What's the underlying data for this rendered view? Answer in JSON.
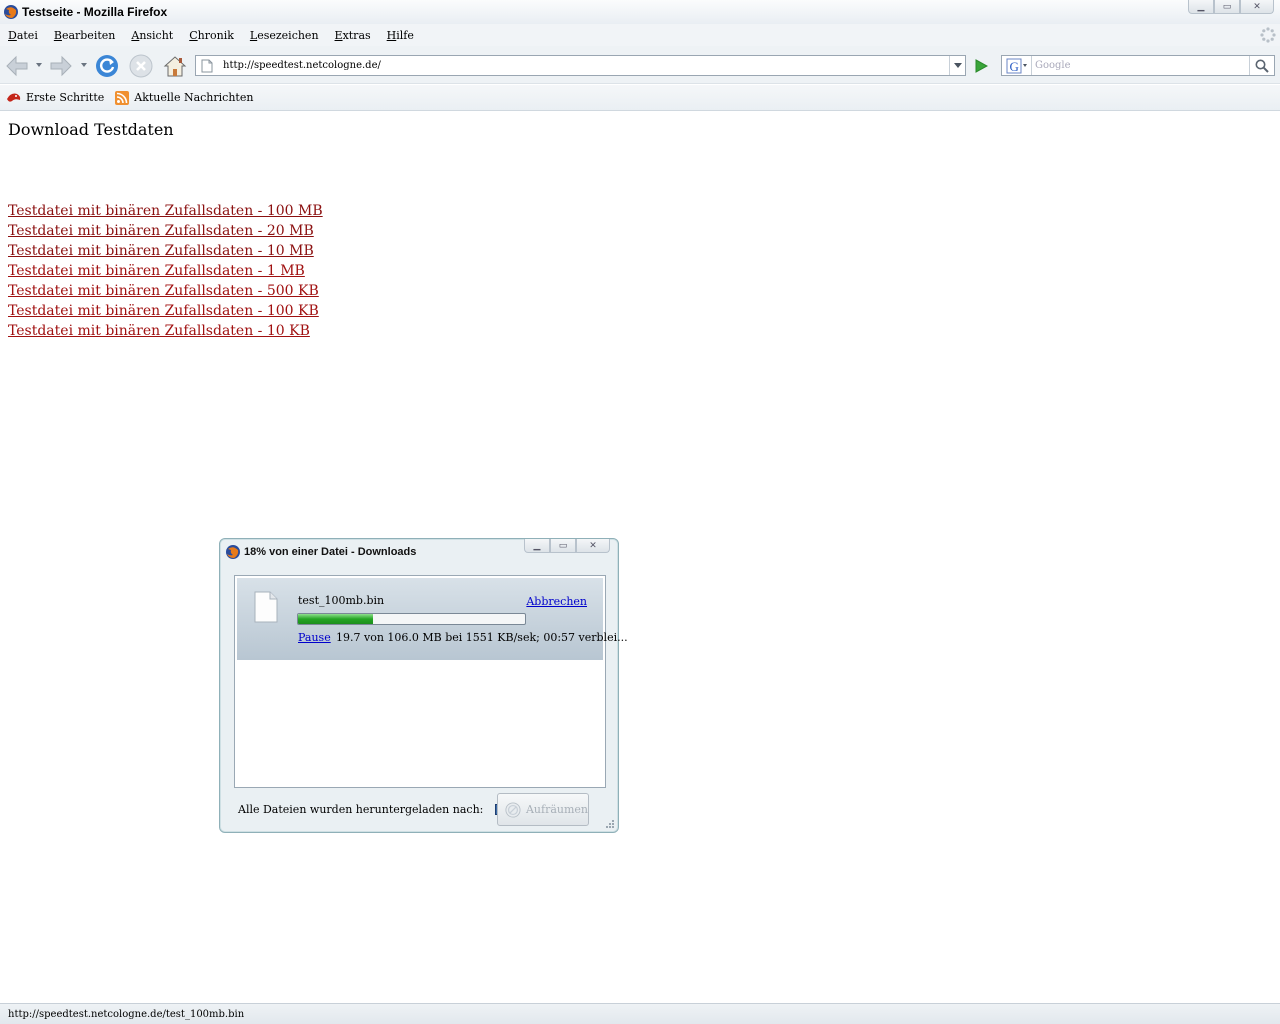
{
  "window": {
    "title": "Testseite - Mozilla Firefox",
    "controls": {
      "minimize": "▭",
      "maximize": "▭",
      "close": "✕"
    }
  },
  "menu": [
    {
      "label": "Datei",
      "accel": "D",
      "rest": "atei"
    },
    {
      "label": "Bearbeiten",
      "accel": "B",
      "rest": "earbeiten"
    },
    {
      "label": "Ansicht",
      "accel": "A",
      "rest": "nsicht"
    },
    {
      "label": "Chronik",
      "accel": "C",
      "rest": "hronik"
    },
    {
      "label": "Lesezeichen",
      "accel": "L",
      "rest": "esezeichen"
    },
    {
      "label": "Extras",
      "accel": "E",
      "rest": "xtras"
    },
    {
      "label": "Hilfe",
      "accel": "H",
      "rest": "ilfe"
    }
  ],
  "nav": {
    "url": "http://speedtest.netcologne.de/",
    "search_placeholder": "Google"
  },
  "bookmarks": [
    {
      "label": "Erste Schritte",
      "icon": "firefox-flag-icon"
    },
    {
      "label": "Aktuelle Nachrichten",
      "icon": "rss-feed-icon"
    }
  ],
  "page": {
    "heading": "Download Testdaten",
    "links": [
      "Testdatei mit binären Zufallsdaten - 100 MB",
      "Testdatei mit binären Zufallsdaten - 20 MB",
      "Testdatei mit binären Zufallsdaten - 10 MB",
      "Testdatei mit binären Zufallsdaten - 1 MB",
      "Testdatei mit binären Zufallsdaten - 500 KB",
      "Testdatei mit binären Zufallsdaten - 100 KB",
      "Testdatei mit binären Zufallsdaten - 10 KB"
    ]
  },
  "status": "http://speedtest.netcologne.de/test_100mb.bin",
  "downloads": {
    "title": "18% von einer Datei - Downloads",
    "item": {
      "filename": "test_100mb.bin",
      "cancel_label": "Abbrechen",
      "pause_label": "Pause",
      "status": "19.7 von 106.0 MB bei 1551 KB/sek; 00:57 verblei...",
      "progress_percent": 33
    },
    "footer_text": "Alle Dateien wurden heruntergeladen nach:",
    "folder_ellipsis": "...",
    "cleanup_label": "Aufräumen"
  },
  "colors": {
    "link": "#8b1010",
    "accent_link": "#0000cc",
    "progress": "#25a525"
  }
}
